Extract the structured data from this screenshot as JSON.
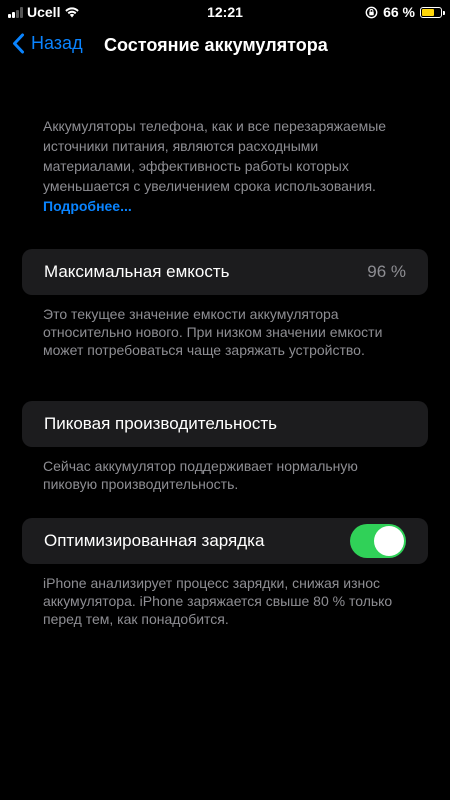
{
  "status_bar": {
    "carrier": "Ucell",
    "time": "12:21",
    "battery_percent": "66 %",
    "battery_level": 0.66,
    "battery_color": "#ffd60a"
  },
  "nav": {
    "back_label": "Назад",
    "title": "Состояние аккумулятора"
  },
  "intro": {
    "text": "Аккумуляторы телефона, как и все перезаряжаемые источники питания, являются расходными материалами, эффективность работы которых уменьшается с увеличением срока использования. ",
    "link": "Подробнее..."
  },
  "max_capacity": {
    "label": "Максимальная емкость",
    "value": "96 %",
    "footnote": "Это текущее значение емкости аккумулятора относительно нового. При низком значении емкости может потребоваться чаще заряжать устройство."
  },
  "peak_performance": {
    "label": "Пиковая производительность",
    "footnote": "Сейчас аккумулятор поддерживает нормальную пиковую производительность."
  },
  "optimized_charging": {
    "label": "Оптимизированная зарядка",
    "enabled": true,
    "footnote": "iPhone анализирует процесс зарядки, снижая износ аккумулятора. iPhone заряжается свыше 80 % только перед тем, как понадобится."
  },
  "colors": {
    "accent": "#0a84ff",
    "toggle_on": "#30d158",
    "cell_bg": "#1c1c1e",
    "secondary_text": "#8e8e93"
  }
}
